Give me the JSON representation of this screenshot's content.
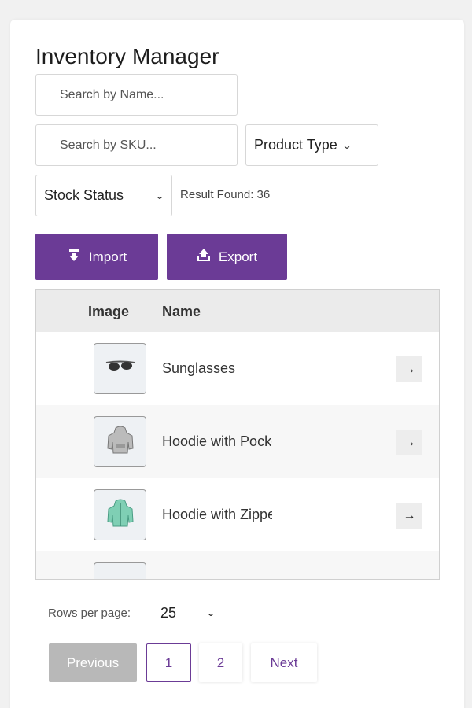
{
  "header": {
    "title": "Inventory Manager"
  },
  "filters": {
    "search_name_placeholder": "Search by Name...",
    "search_sku_placeholder": "Search by SKU...",
    "product_type_label": "Product Type",
    "stock_status_label": "Stock Status",
    "result_found": "Result Found: 36"
  },
  "actions": {
    "import_label": "Import",
    "export_label": "Export"
  },
  "table": {
    "columns": [
      "Image",
      "Name"
    ],
    "rows": [
      {
        "name": "Sunglasses",
        "icon": "sunglasses-icon",
        "arrow": "→"
      },
      {
        "name": "Hoodie with Pocket",
        "icon": "hoodie-pocket-icon",
        "arrow": "→"
      },
      {
        "name": "Hoodie with Zipper",
        "icon": "hoodie-zipper-icon",
        "arrow": "→"
      },
      {
        "name": "",
        "icon": "product-thumbnail-icon",
        "arrow": ""
      }
    ]
  },
  "pagination": {
    "rows_per_page_label": "Rows per page:",
    "rows_per_page_value": "25",
    "previous_label": "Previous",
    "pages": [
      "1",
      "2"
    ],
    "next_label": "Next"
  },
  "colors": {
    "accent": "#6b3b96",
    "disabled": "#b8b8b8"
  }
}
